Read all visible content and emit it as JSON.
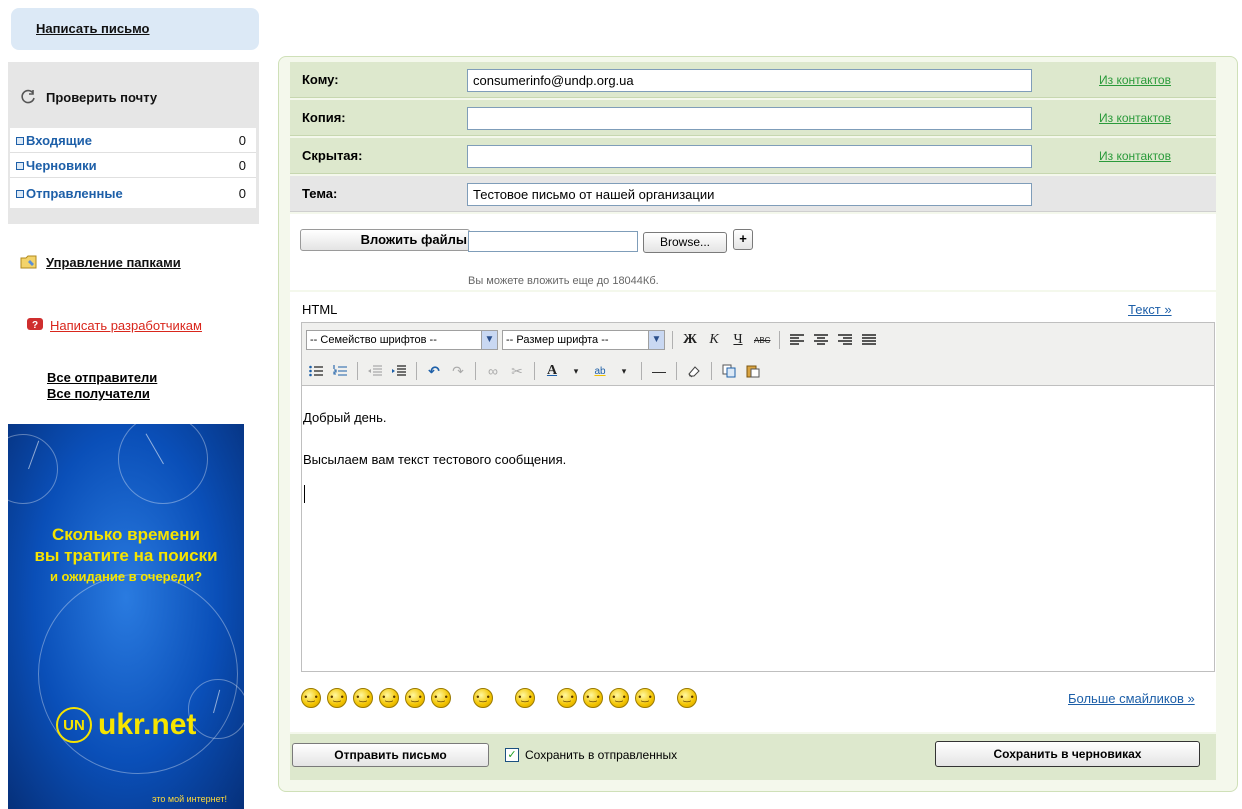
{
  "sidebar": {
    "compose_label": "Написать письмо",
    "check_mail_label": "Проверить почту",
    "folders": [
      {
        "label": "Входящие",
        "count": "0"
      },
      {
        "label": "Черновики",
        "count": "0"
      },
      {
        "label": "Отправленные",
        "count": "0"
      }
    ],
    "manage_folders_label": "Управление папками",
    "write_devs_label": "Написать разработчикам",
    "all_senders_label": "Все отправители",
    "all_recipients_label": "Все получатели"
  },
  "banner": {
    "line1": "Сколько времени",
    "line2": "вы тратите на поиски",
    "line3": "и ожидание в очереди?",
    "brand": "ukr.net",
    "slogan": "это мой интернет!"
  },
  "compose": {
    "to_label": "Кому:",
    "to_value": "consumerinfo@undp.org.ua",
    "cc_label": "Копия:",
    "cc_value": "",
    "bcc_label": "Скрытая:",
    "bcc_value": "",
    "subject_label": "Тема:",
    "subject_value": "Тестовое письмо от нашей организации",
    "from_contacts_label": "Из контактов",
    "attach_button": "Вложить файлы",
    "browse_button": "Browse...",
    "add_attach_button": "+",
    "attach_note": "Вы можете вложить еще до 18044Кб.",
    "html_label": "HTML",
    "text_mode_link": "Текст »"
  },
  "toolbar": {
    "font_family_placeholder": "-- Семейство шрифтов --",
    "font_size_placeholder": "-- Размер шрифта --"
  },
  "editor": {
    "line1": "Добрый день.",
    "line2": "Высылаем вам текст тестового сообщения."
  },
  "smileys": {
    "more_label": "Больше смайликов »"
  },
  "actions": {
    "send_label": "Отправить письмо",
    "save_sent_label": "Сохранить в отправленных",
    "save_draft_label": "Сохранить в черновиках"
  },
  "colors": {
    "accent_blue": "#1d5fa8",
    "panel_green": "#dde8cd",
    "link_green": "#2a9a3a",
    "dev_link_red": "#d9261c",
    "banner_yellow": "#f6e400"
  }
}
